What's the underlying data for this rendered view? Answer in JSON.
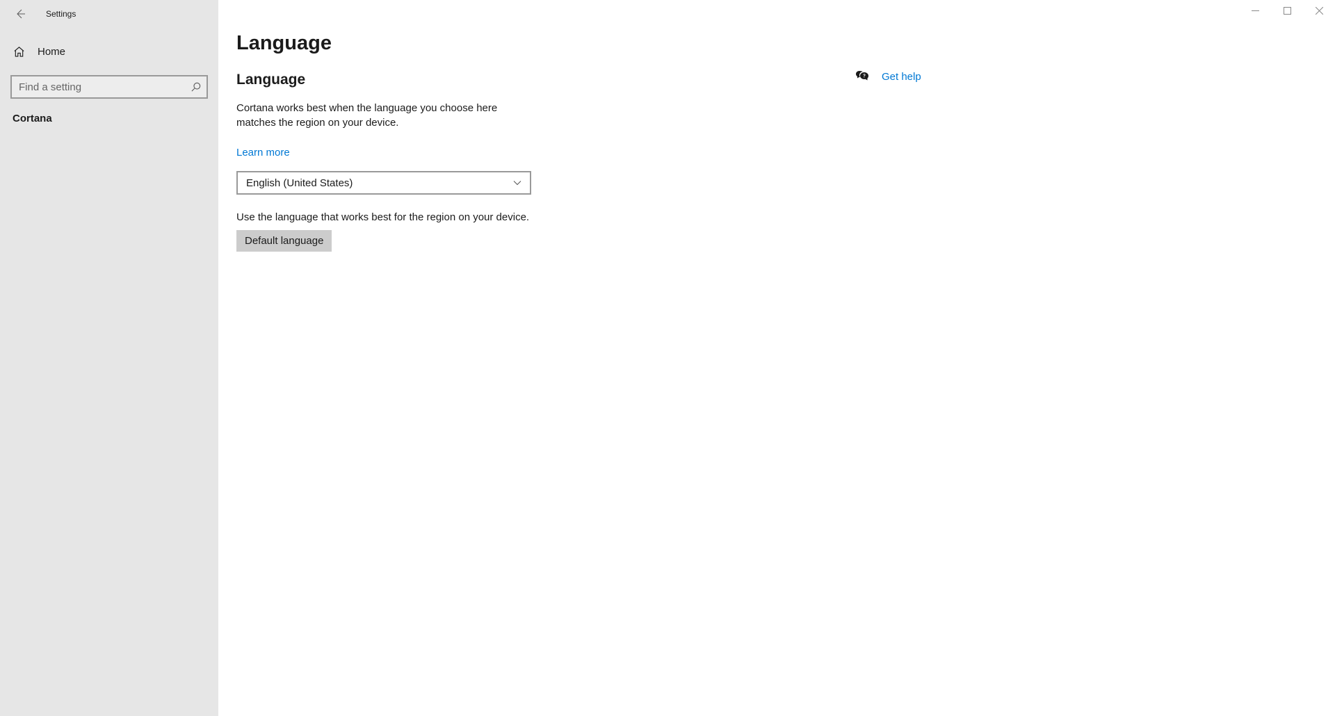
{
  "titlebar": {
    "label": "Settings"
  },
  "sidebar": {
    "home_label": "Home",
    "search_placeholder": "Find a setting",
    "category_label": "Cortana"
  },
  "main": {
    "page_title": "Language",
    "section_title": "Language",
    "description": "Cortana works best when the language you choose here matches the region on your device.",
    "learn_more": "Learn more",
    "selected_language": "English (United States)",
    "hint": "Use the language that works best for the region on your device.",
    "default_button": "Default language"
  },
  "help": {
    "label": "Get help"
  }
}
